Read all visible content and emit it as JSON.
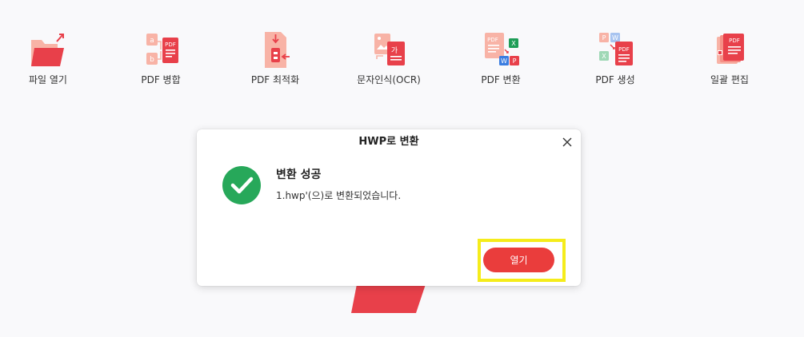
{
  "toolbar": {
    "items": [
      {
        "label": "파일 열기",
        "icon": "open-file-icon"
      },
      {
        "label": "PDF 병합",
        "icon": "merge-pdf-icon"
      },
      {
        "label": "PDF 최적화",
        "icon": "compress-pdf-icon"
      },
      {
        "label": "문자인식(OCR)",
        "icon": "ocr-icon"
      },
      {
        "label": "PDF 변환",
        "icon": "convert-pdf-icon"
      },
      {
        "label": "PDF 생성",
        "icon": "create-pdf-icon"
      },
      {
        "label": "일괄 편집",
        "icon": "batch-edit-icon"
      }
    ]
  },
  "dialog": {
    "title": "HWP로 변환",
    "message_title": "변환 성공",
    "message_body": "1.hwp'(으)로 변환되었습니다.",
    "open_label": "열기"
  },
  "colors": {
    "accent": "#ea3d3c",
    "success": "#27a85a",
    "highlight": "#f5ec1b"
  }
}
